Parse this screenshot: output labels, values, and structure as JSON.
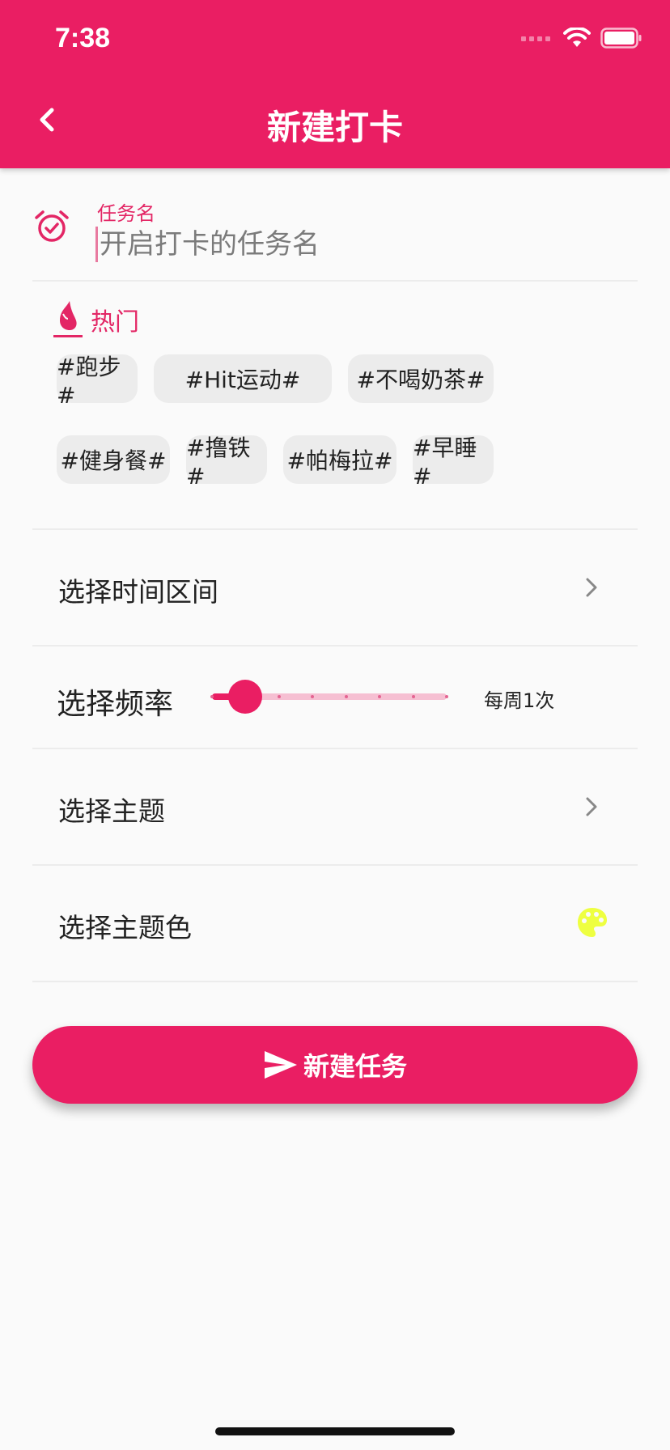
{
  "status_bar": {
    "time": "7:38"
  },
  "app_bar": {
    "title": "新建打卡"
  },
  "task": {
    "label": "任务名",
    "placeholder": "开启打卡的任务名",
    "value": ""
  },
  "hot": {
    "label": "热门",
    "tags": [
      "#跑步#",
      "#Hit运动#",
      "#不喝奶茶#",
      "#健身餐#",
      "#撸铁#",
      "#帕梅拉#",
      "#早睡#"
    ]
  },
  "time_range": {
    "label": "选择时间区间"
  },
  "frequency": {
    "label": "选择频率",
    "value_text": "每周1次",
    "value": 1,
    "min": 0,
    "max": 7,
    "steps": 7
  },
  "theme": {
    "label": "选择主题"
  },
  "theme_color": {
    "label": "选择主题色",
    "color": "#eeff41"
  },
  "submit": {
    "label": "新建任务"
  },
  "colors": {
    "primary": "#ea1e63",
    "slider_track": "#f6bfd2",
    "tag_bg": "#ececec"
  }
}
